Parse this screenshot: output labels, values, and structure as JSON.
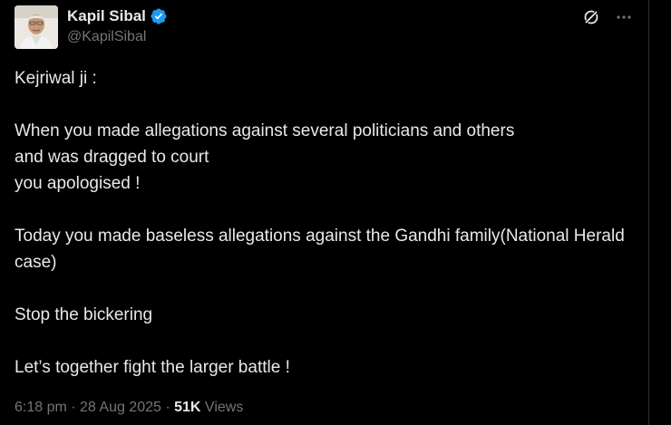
{
  "author": {
    "name": "Kapil Sibal",
    "handle": "@KapilSibal",
    "verified_color": "#1d9bf0"
  },
  "icons": {
    "grok": "grok-icon",
    "more": "more-icon",
    "verified": "verified-badge-icon"
  },
  "tweet": {
    "lines": [
      "Kejriwal ji :",
      "",
      "When you made allegations against several politicians and others",
      "and was dragged to court",
      "you apologised !",
      "",
      "Today you made baseless allegations against the Gandhi family(National Herald case)",
      "",
      "Stop the bickering",
      "",
      "Let’s together fight the larger battle !"
    ]
  },
  "meta": {
    "time": "6:18 pm",
    "separator": " · ",
    "date": "28 Aug 2025",
    "views_count": "51K",
    "views_label": " Views"
  },
  "colors": {
    "background": "#000000",
    "text": "#e7e9ea",
    "secondary": "#71767b",
    "border": "#2f3336"
  }
}
